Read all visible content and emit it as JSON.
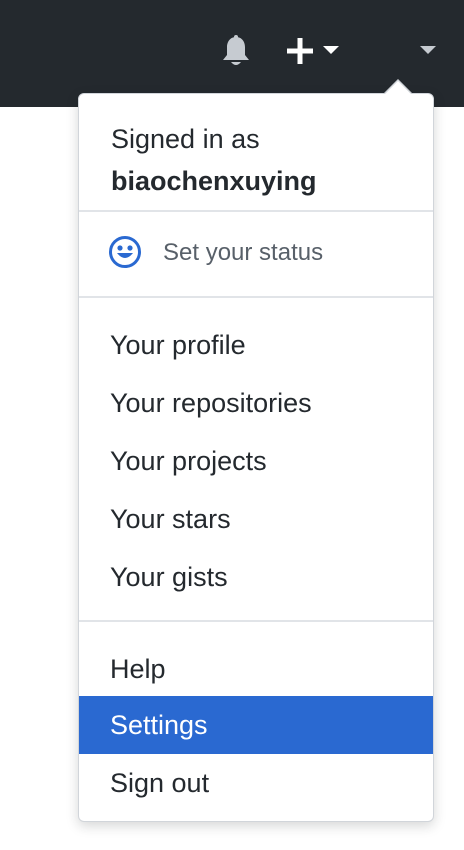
{
  "header": {
    "notifications_icon": "bell-icon",
    "create_icon": "plus-icon",
    "create_caret_icon": "caret-down-icon",
    "avatar_caret_icon": "caret-down-icon"
  },
  "menu": {
    "signed_in_prefix": "Signed in as",
    "username": "biaochenxuying",
    "status": {
      "icon": "smiley-icon",
      "label": "Set your status"
    },
    "group1": [
      "Your profile",
      "Your repositories",
      "Your projects",
      "Your stars",
      "Your gists"
    ],
    "group2": [
      "Help",
      "Settings",
      "Sign out"
    ],
    "active_item": "Settings",
    "active_color": "#2a69d1"
  }
}
